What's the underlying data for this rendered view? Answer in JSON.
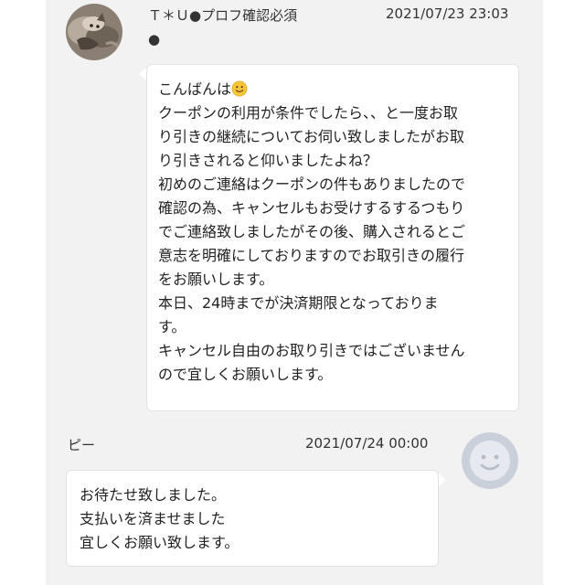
{
  "messages": [
    {
      "sender": "Ｔ＊Ｕ●プロフ確認必須",
      "sender_suffix": "●",
      "timestamp": "2021/07/23 23:03",
      "avatar": "cat-photo-avatar",
      "emoji": "slightly-smiling-face",
      "lines": [
        "こんばんは",
        "クーポンの利用が条件でしたら、、と一度お取",
        "り引きの継続についてお伺い致しましたがお取",
        "り引きされると仰いましたよね？",
        "初めのご連絡はクーポンの件もありましたので",
        "確認の為、キャンセルもお受けするするつもり",
        "でご連絡致しましたがその後、購入されるとご",
        "意志を明確にしておりますのでお取引きの履行",
        "をお願いします。",
        "本日、24時までが決済期限となっておりま",
        "す。",
        "キャンセル自由のお取り引きではございません",
        "ので宜しくお願いします。"
      ]
    },
    {
      "sender": "ピー",
      "timestamp": "2021/07/24 00:00",
      "avatar": "default-smiley-avatar",
      "lines": [
        "お待たせ致しました。",
        "支払いを済ませました",
        "宜しくお願い致します。"
      ]
    }
  ],
  "colors": {
    "panel_bg": "#f2f2f2",
    "bubble_bg": "#ffffff",
    "default_avatar": "#c9d0db"
  }
}
